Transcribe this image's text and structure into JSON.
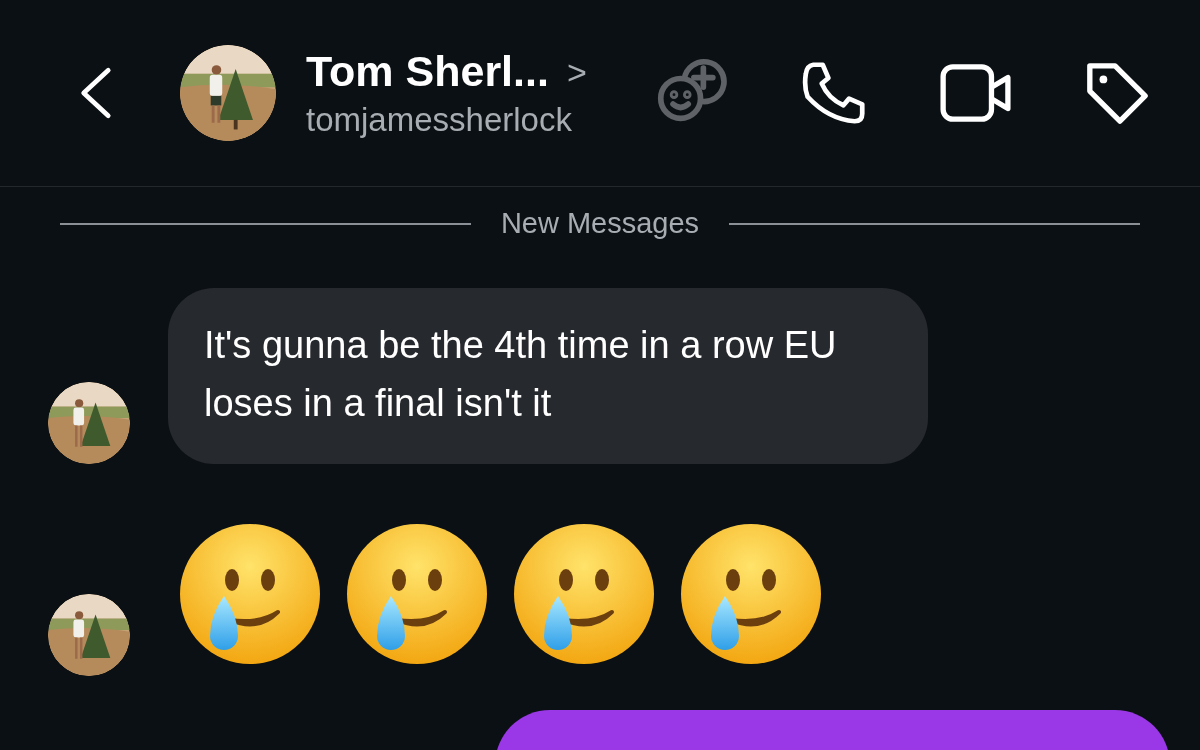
{
  "header": {
    "name": "Tom Sherl...",
    "chevron": ">",
    "username": "tomjamessherlock"
  },
  "divider_label": "New Messages",
  "messages": [
    {
      "kind": "text",
      "text": "It's gunna be the 4th time in a row EU loses in a final isn't it"
    },
    {
      "kind": "emoji",
      "emojis": [
        {
          "kind": "smiling-with-tear"
        },
        {
          "kind": "smiling-with-tear"
        },
        {
          "kind": "smiling-with-tear"
        },
        {
          "kind": "smiling-with-tear"
        }
      ]
    },
    {
      "kind": "outgoing"
    }
  ]
}
